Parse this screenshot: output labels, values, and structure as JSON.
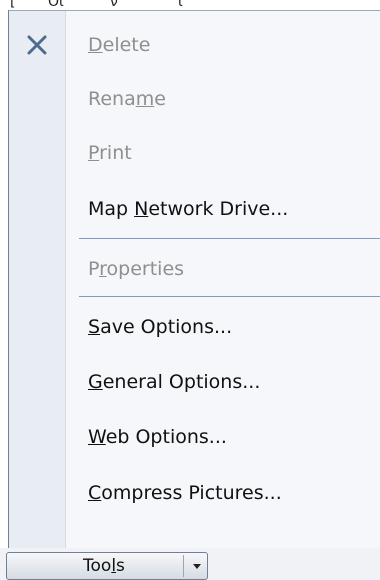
{
  "menu": {
    "items": [
      {
        "id": "delete",
        "pre": "",
        "accel": "D",
        "post": "elete",
        "enabled": false,
        "icon": "close-icon"
      },
      {
        "id": "rename",
        "pre": "Rena",
        "accel": "m",
        "post": "e",
        "enabled": false
      },
      {
        "id": "print",
        "pre": "",
        "accel": "P",
        "post": "rint",
        "enabled": false
      },
      {
        "id": "map-network-drive",
        "pre": "Map ",
        "accel": "N",
        "post": "etwork Drive...",
        "enabled": true
      },
      {
        "id": "properties",
        "pre": "P",
        "accel": "r",
        "post": "operties",
        "enabled": false
      },
      {
        "id": "save-options",
        "pre": "",
        "accel": "S",
        "post": "ave Options...",
        "enabled": true
      },
      {
        "id": "general-options",
        "pre": "",
        "accel": "G",
        "post": "eneral Options...",
        "enabled": true
      },
      {
        "id": "web-options",
        "pre": "",
        "accel": "W",
        "post": "eb Options...",
        "enabled": true
      },
      {
        "id": "compress-pictures",
        "pre": "",
        "accel": "C",
        "post": "ompress Pictures...",
        "enabled": true
      }
    ]
  },
  "toolbar": {
    "tools_label_pre": "Too",
    "tools_label_accel": "l",
    "tools_label_post": "s"
  },
  "colors": {
    "disabled_text": "#8f8f8f",
    "enabled_text": "#111111",
    "separator": "#7f9dc1",
    "delete_icon": "#4f6a8f"
  }
}
